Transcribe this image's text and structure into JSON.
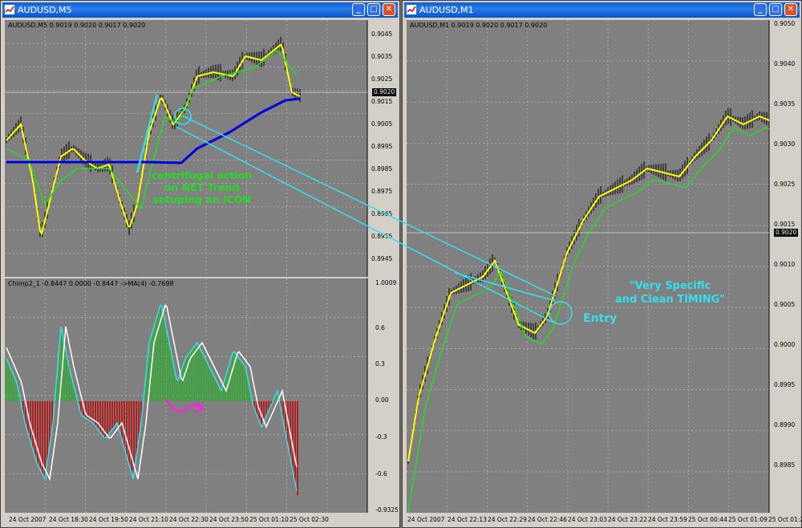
{
  "windows": [
    {
      "title": "AUDUSD,M5",
      "main_pane": {
        "label": "AUDUSD,M5  0.9019 0.9020 0.9017 0.9020",
        "y_ticks": [
          "0.9045",
          "0.9035",
          "0.9025",
          "0.9015",
          "0.9005",
          "0.8995",
          "0.8985",
          "0.8975",
          "0.8965",
          "0.8955",
          "0.8945"
        ],
        "current_price": "0.9020"
      },
      "indicator_pane": {
        "label": "Chimp2_1 -0.8447 0.0000 -0.8447  ->MA(4) -0.7698",
        "y_ticks": [
          "1.0009",
          "0.6",
          "0.3",
          "0.00",
          "-0.3",
          "-0.6",
          "-0.9325"
        ]
      },
      "x_ticks": [
        "24 Oct 2007",
        "24 Oct 18:30",
        "24 Oct 19:50",
        "24 Oct 21:10",
        "24 Oct 22:30",
        "24 Oct 23:50",
        "25 Oct 01:10",
        "25 Oct 02:30"
      ],
      "annotation": "centrifugal action\non NET Trend\nsetuping an ICON"
    },
    {
      "title": "AUDUSD,M1",
      "main_pane": {
        "label": "AUDUSD,M1  0.9019 0.9020 0.9017 0.9020",
        "y_ticks": [
          "0.9050",
          "0.9040",
          "0.9035",
          "0.9030",
          "0.9025",
          "0.9015",
          "0.9010",
          "0.9005",
          "0.9000",
          "0.8995",
          "0.8990",
          "0.8985"
        ],
        "current_price": "0.9020"
      },
      "x_ticks": [
        "24 Oct 2007",
        "24 Oct 22:13",
        "24 Oct 22:29",
        "24 Oct 22:46",
        "24 Oct 23:03",
        "24 Oct 23:22",
        "24 Oct 23:59",
        "25 Oct 00:44",
        "25 Oct 01:09",
        "25 Oct 01:2"
      ],
      "annotation_entry": "Entry",
      "annotation_timing": "\"Very Specific\nand Clean TIMING\""
    }
  ],
  "icons": [
    "chart-window-icon",
    "minimize-icon",
    "maximize-icon",
    "close-icon"
  ],
  "colors": {
    "yellow": "#ffff00",
    "green": "#22dd22",
    "blue": "#0000dd",
    "cyan": "#33e0ee",
    "magenta": "#ff22dd",
    "hist_green": "#33aa33",
    "hist_red": "#b02020"
  }
}
